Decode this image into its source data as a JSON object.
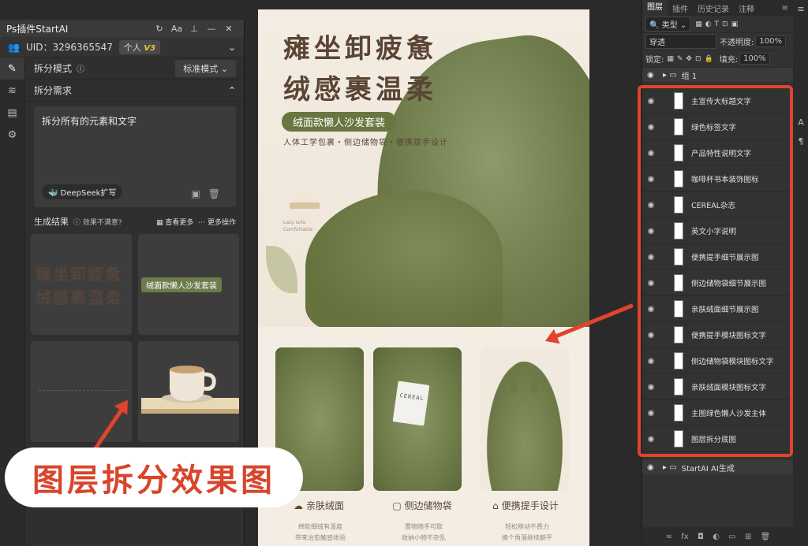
{
  "plugin": {
    "title": "Ps插件StartAI",
    "uid": "UID：3296365547",
    "plan_label": "个人",
    "plan_version": "V3",
    "split_mode_label": "拆分模式",
    "split_mode_value": "标准模式",
    "split_req_label": "拆分需求",
    "request_text": "拆分所有的元素和文字",
    "deepseek_label": "DeepSeek扩写",
    "results_label": "生成结果",
    "unsatisfied": "效果不满意?",
    "view_more": "查看更多",
    "more_ops": "更多操作",
    "result1_text": "瘫坐卸疲惫\n绒感裹温柔",
    "result2_text": "绒面款懒人沙发套装"
  },
  "poster": {
    "title_line1": "瘫坐卸疲惫",
    "title_line2": "绒感裹温柔",
    "pill": "绒面款懒人沙发套装",
    "subtitle": "人体工学包裹・侧边储物袋・便携提手设计",
    "lazy_line1": "Lazy sofa",
    "lazy_line2": "Comfortable",
    "cereal": "CEREAL",
    "features": [
      {
        "icon": "☁",
        "title": "亲肤绒面",
        "line1": "绵软细绒有温度",
        "line2": "带来治愈触感体验"
      },
      {
        "icon": "▢",
        "title": "侧边储物袋",
        "line1": "置物随手可取",
        "line2": "收纳小物不杂乱"
      },
      {
        "icon": "⌂",
        "title": "便携提手设计",
        "line1": "轻松移动不费力",
        "line2": "换个角落继续躺平"
      }
    ]
  },
  "caption": "图层拆分效果图",
  "layers": {
    "tabs": [
      "图层",
      "插件",
      "历史记录",
      "注释"
    ],
    "kind": "类型",
    "blend": "穿透",
    "opacity_label": "不透明度:",
    "opacity": "100%",
    "lock_label": "锁定:",
    "fill_label": "填充:",
    "fill": "100%",
    "group": "组 1",
    "items": [
      "主宣传大标题文字",
      "绿色标签文字",
      "产品特性说明文字",
      "咖啡杯书本装饰图标",
      "CEREAL杂志",
      "英文小字说明",
      "便携提手细节展示图",
      "侧边储物袋细节展示图",
      "亲肤绒面细节展示图",
      "便携提手模块图标文字",
      "侧边储物袋模块图标文字",
      "亲肤绒面模块图标文字",
      "主图绿色懒人沙发主体",
      "图层拆分底图"
    ],
    "ai_layer": "StartAI AI生成"
  }
}
